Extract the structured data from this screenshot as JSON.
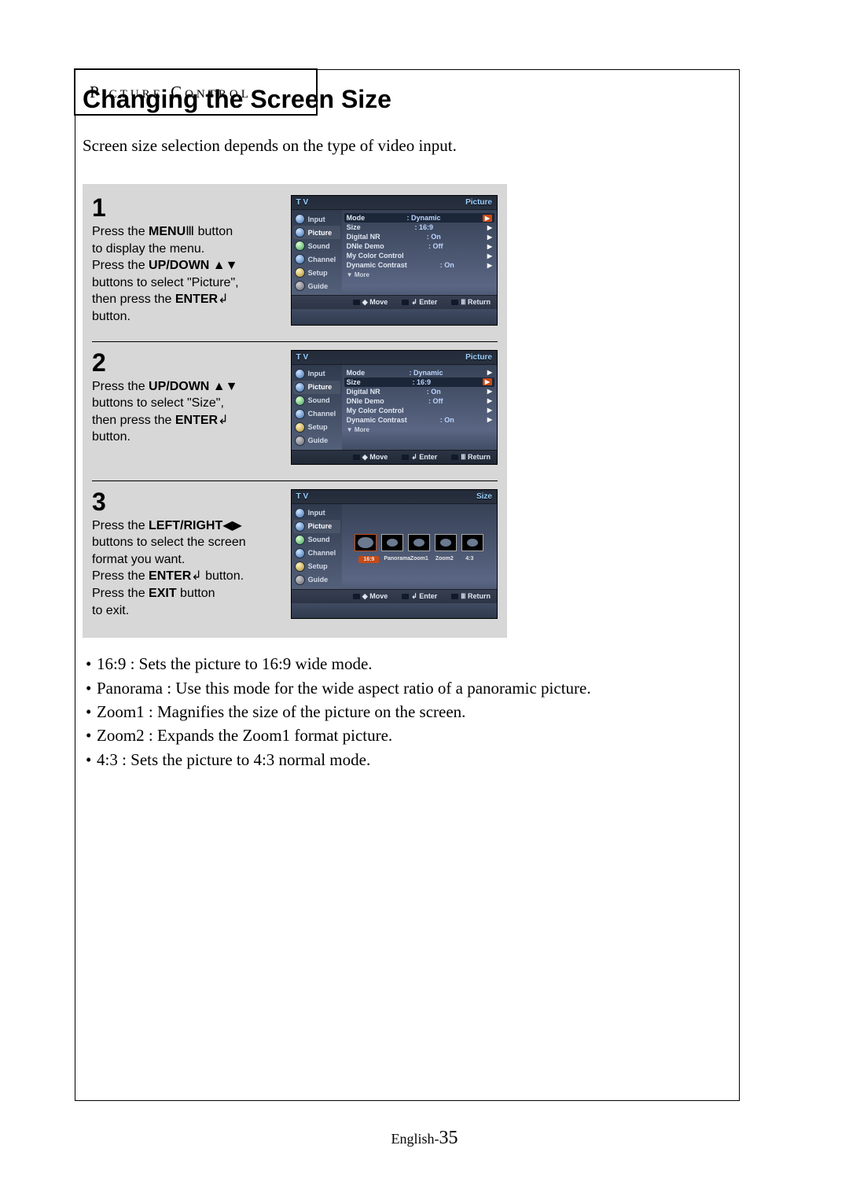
{
  "header": {
    "label": "Picture Control"
  },
  "title": "Changing the Screen Size",
  "intro": "Screen size selection depends on the type of video input.",
  "steps": [
    {
      "num": "1",
      "lines": [
        {
          "pre": "Press the ",
          "bold": "MENU",
          "icon": "Ⅲ",
          "post": " button"
        },
        {
          "plain": "to display the menu."
        },
        {
          "pre": "Press the ",
          "bold": "UP/DOWN",
          "icon": " ▲▼",
          "post": ""
        },
        {
          "plain": "buttons to select \"Picture\","
        },
        {
          "pre": "then press the ",
          "bold": "ENTER",
          "icon": "↲",
          "post": ""
        },
        {
          "plain": "button."
        }
      ],
      "osd": {
        "tl": "T V",
        "tr": "Picture",
        "side": [
          "Input",
          "Picture",
          "Sound",
          "Channel",
          "Setup",
          "Guide"
        ],
        "side_sel": 1,
        "menu": [
          {
            "label": "Mode",
            "val": ": Dynamic",
            "sel": true
          },
          {
            "label": "Size",
            "val": ": 16:9"
          },
          {
            "label": "Digital NR",
            "val": ": On"
          },
          {
            "label": "DNIe Demo",
            "val": ": Off"
          },
          {
            "label": "My Color Control",
            "val": ""
          },
          {
            "label": "Dynamic Contrast",
            "val": ": On"
          }
        ],
        "more": "▼ More",
        "footer": [
          "Move",
          "Enter",
          "Return"
        ],
        "footer_prefix": [
          "◆",
          "↲",
          "Ⅲ"
        ]
      }
    },
    {
      "num": "2",
      "lines": [
        {
          "pre": "Press the ",
          "bold": "UP/DOWN",
          "icon": " ▲▼",
          "post": ""
        },
        {
          "plain": "buttons to select \"Size\","
        },
        {
          "pre": "then press the ",
          "bold": "ENTER",
          "icon": "↲",
          "post": ""
        },
        {
          "plain": "button."
        }
      ],
      "osd": {
        "tl": "T V",
        "tr": "Picture",
        "side": [
          "Input",
          "Picture",
          "Sound",
          "Channel",
          "Setup",
          "Guide"
        ],
        "side_sel": 1,
        "menu": [
          {
            "label": "Mode",
            "val": ": Dynamic"
          },
          {
            "label": "Size",
            "val": ": 16:9",
            "sel": true
          },
          {
            "label": "Digital NR",
            "val": ": On"
          },
          {
            "label": "DNIe Demo",
            "val": ": Off"
          },
          {
            "label": "My Color Control",
            "val": ""
          },
          {
            "label": "Dynamic Contrast",
            "val": ": On"
          }
        ],
        "more": "▼ More",
        "footer": [
          "Move",
          "Enter",
          "Return"
        ],
        "footer_prefix": [
          "◆",
          "↲",
          "Ⅲ"
        ]
      }
    },
    {
      "num": "3",
      "lines": [
        {
          "pre": "Press the ",
          "bold": "LEFT/RIGHT",
          "icon": "◀▶",
          "post": ""
        },
        {
          "plain": "buttons to select the screen"
        },
        {
          "plain": "format you want."
        },
        {
          "pre": "Press the ",
          "bold": "ENTER",
          "icon": "↲",
          "post": "  button."
        },
        {
          "pre": "Press the ",
          "bold": "EXIT",
          "icon": "",
          "post": " button"
        },
        {
          "plain": "to exit."
        }
      ],
      "osd": {
        "tl": "T V",
        "tr": "Size",
        "side": [
          "Input",
          "Picture",
          "Sound",
          "Channel",
          "Setup",
          "Guide"
        ],
        "side_sel": 1,
        "size_mode": true,
        "sizes": [
          "16:9",
          "Panorama",
          "Zoom1",
          "Zoom2",
          "4:3"
        ],
        "size_sel": 0,
        "footer": [
          "Move",
          "Enter",
          "Return"
        ],
        "footer_prefix": [
          "◆",
          "↲",
          "Ⅲ"
        ]
      }
    }
  ],
  "bullets": [
    "16:9 : Sets the picture to 16:9 wide mode.",
    "Panorama : Use this mode for the wide aspect ratio of a panoramic picture.",
    "Zoom1 : Magnifies the size of the picture on the screen.",
    "Zoom2 : Expands the Zoom1 format picture.",
    "4:3 : Sets the picture to 4:3 normal mode."
  ],
  "footer": {
    "lang": "English-",
    "page": "35"
  }
}
